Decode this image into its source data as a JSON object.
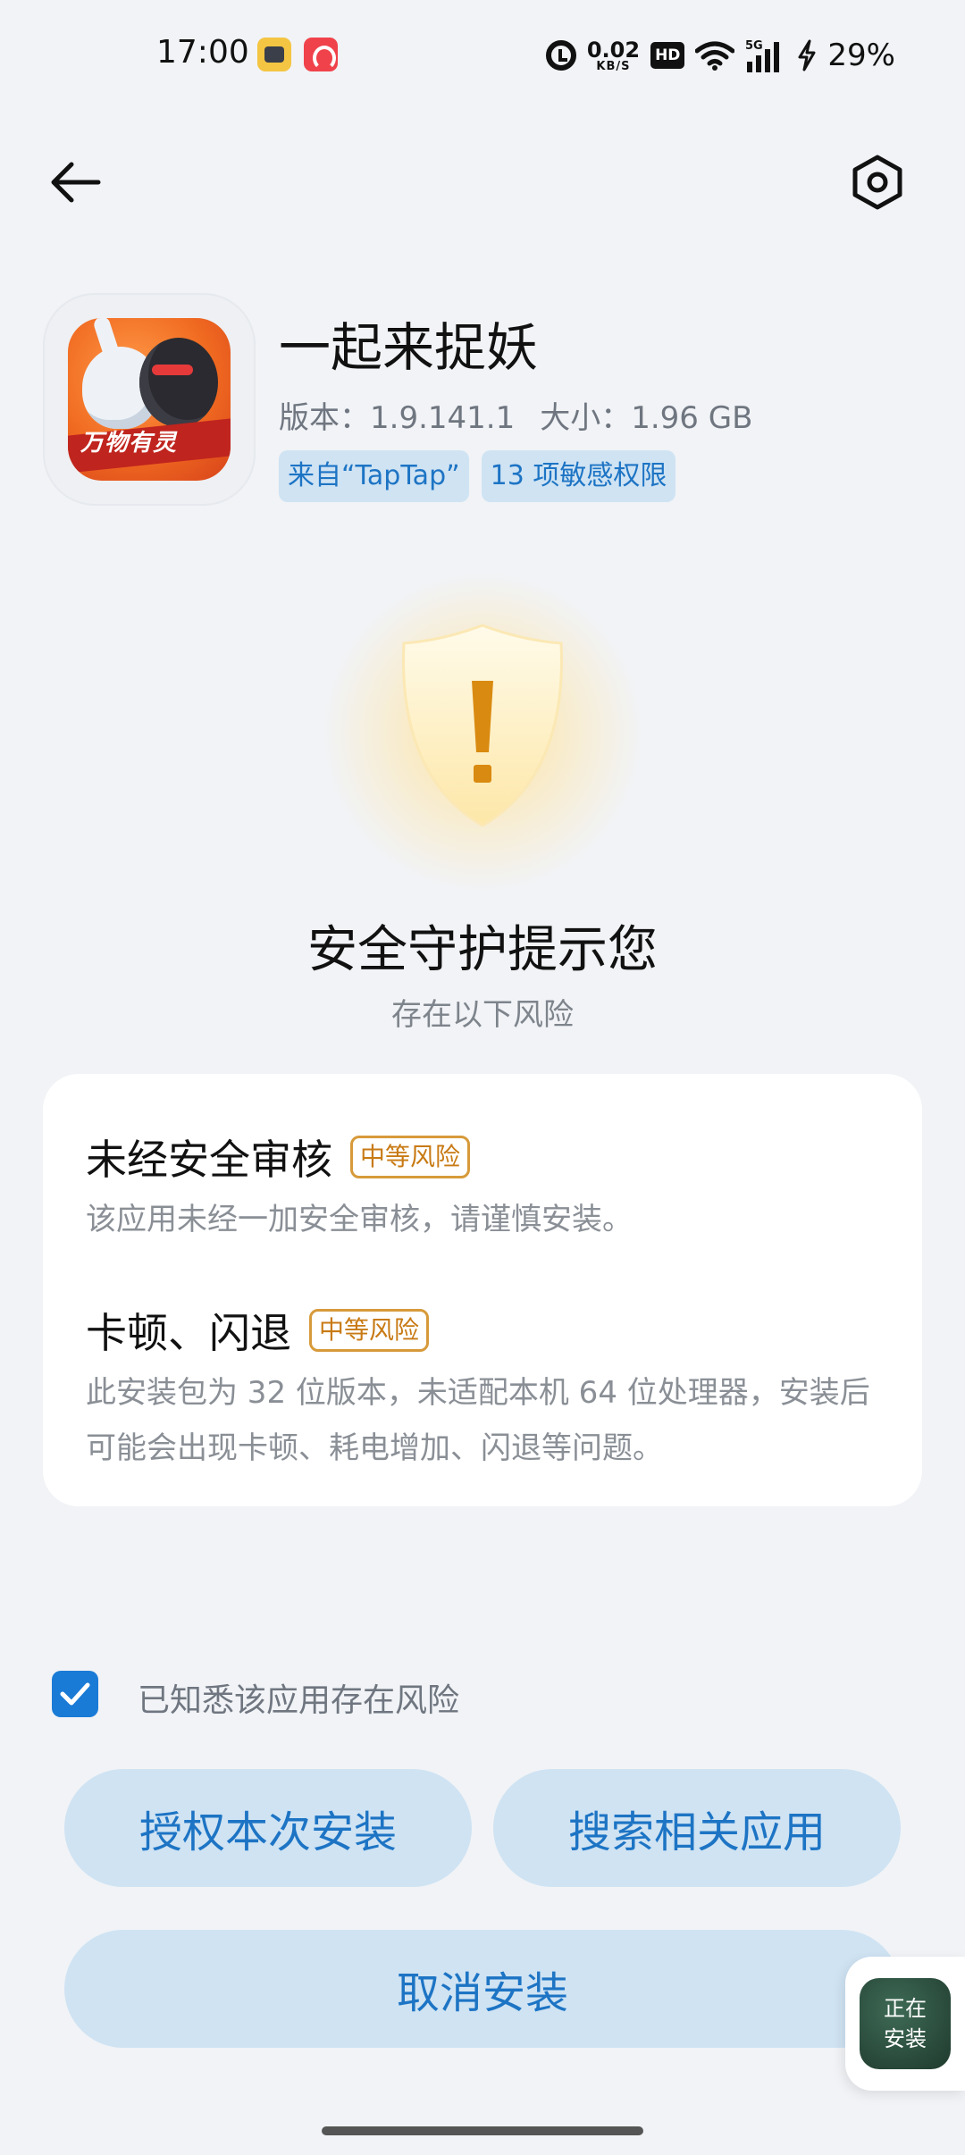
{
  "status_bar": {
    "time": "17:00",
    "net_speed_value": "0.02",
    "net_speed_unit": "KB/S",
    "hd_label": "HD",
    "network_type": "5G",
    "battery": "29%",
    "notification_icons": [
      "security-app-icon",
      "shopping-app-icon"
    ]
  },
  "header": {
    "back_icon": "back-arrow-icon",
    "settings_icon": "settings-hexagon-icon"
  },
  "app": {
    "name": "一起来捉妖",
    "icon_banner": "万物有灵",
    "version_label": "版本：1.9.141.1",
    "size_label": "大小：1.96 GB",
    "tags": [
      "来自“TapTap”",
      "13 项敏感权限"
    ]
  },
  "warning": {
    "shield_icon": "shield-warning-icon",
    "headline": "安全守护提示您",
    "subhead": "存在以下风险"
  },
  "risks": [
    {
      "title": "未经安全审核",
      "badge": "中等风险",
      "description": "该应用未经一加安全审核，请谨慎安装。"
    },
    {
      "title": "卡顿、闪退",
      "badge": "中等风险",
      "description": "此安装包为 32 位版本，未适配本机 64 位处理器，安装后可能会出现卡顿、耗电增加、闪退等问题。"
    }
  ],
  "acknowledge": {
    "checked": true,
    "label": "已知悉该应用存在风险"
  },
  "buttons": {
    "authorize": "授权本次安装",
    "search": "搜索相关应用",
    "cancel": "取消安装"
  },
  "floating": {
    "line1": "正在",
    "line2": "安装"
  },
  "colors": {
    "background": "#f1f3f6",
    "accent": "#1d74c4",
    "button_bg": "#cfe3f3",
    "risk_badge": "#c87a14",
    "checkbox": "#1a7bd6"
  }
}
